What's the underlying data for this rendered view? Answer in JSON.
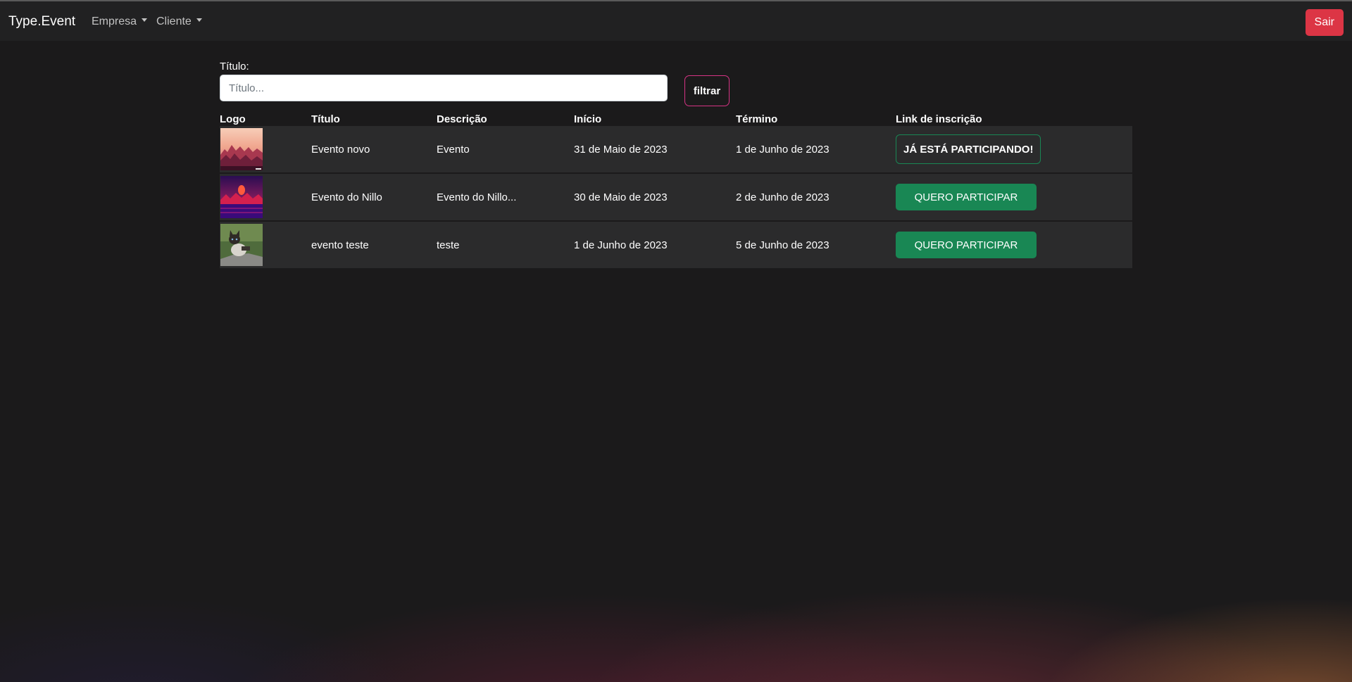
{
  "navbar": {
    "brand": "Type.Event",
    "menus": [
      {
        "label": "Empresa"
      },
      {
        "label": "Cliente"
      }
    ],
    "logout_label": "Sair"
  },
  "filter": {
    "label": "Título:",
    "placeholder": "Título...",
    "value": "",
    "button_label": "filtrar"
  },
  "table": {
    "headers": [
      "Logo",
      "Título",
      "Descrição",
      "Início",
      "Término",
      "Link de inscrição"
    ],
    "rows": [
      {
        "logo": "sunset-landscape-image",
        "title": "Evento novo",
        "description": "Evento",
        "start": "31 de Maio de 2023",
        "end": "1 de Junho de 2023",
        "action": "JÁ ESTÁ PARTICIPANDO!"
      },
      {
        "logo": "synthwave-sun-image",
        "title": "Evento do Nillo",
        "description": "Evento do Nillo...",
        "start": "30 de Maio de 2023",
        "end": "2 de Junho de 2023",
        "action": "QUERO PARTICIPAR"
      },
      {
        "logo": "cat-photo-image",
        "title": "evento teste",
        "description": "teste",
        "start": "1 de Junho de 2023",
        "end": "5 de Junho de 2023",
        "action": "QUERO PARTICIPAR"
      }
    ]
  },
  "colors": {
    "background": "#1b1a1b",
    "navbar": "#212122",
    "danger": "#dc3545",
    "success": "#198754",
    "accent_pink": "#d63384",
    "row_background": "#2b2b2c"
  }
}
